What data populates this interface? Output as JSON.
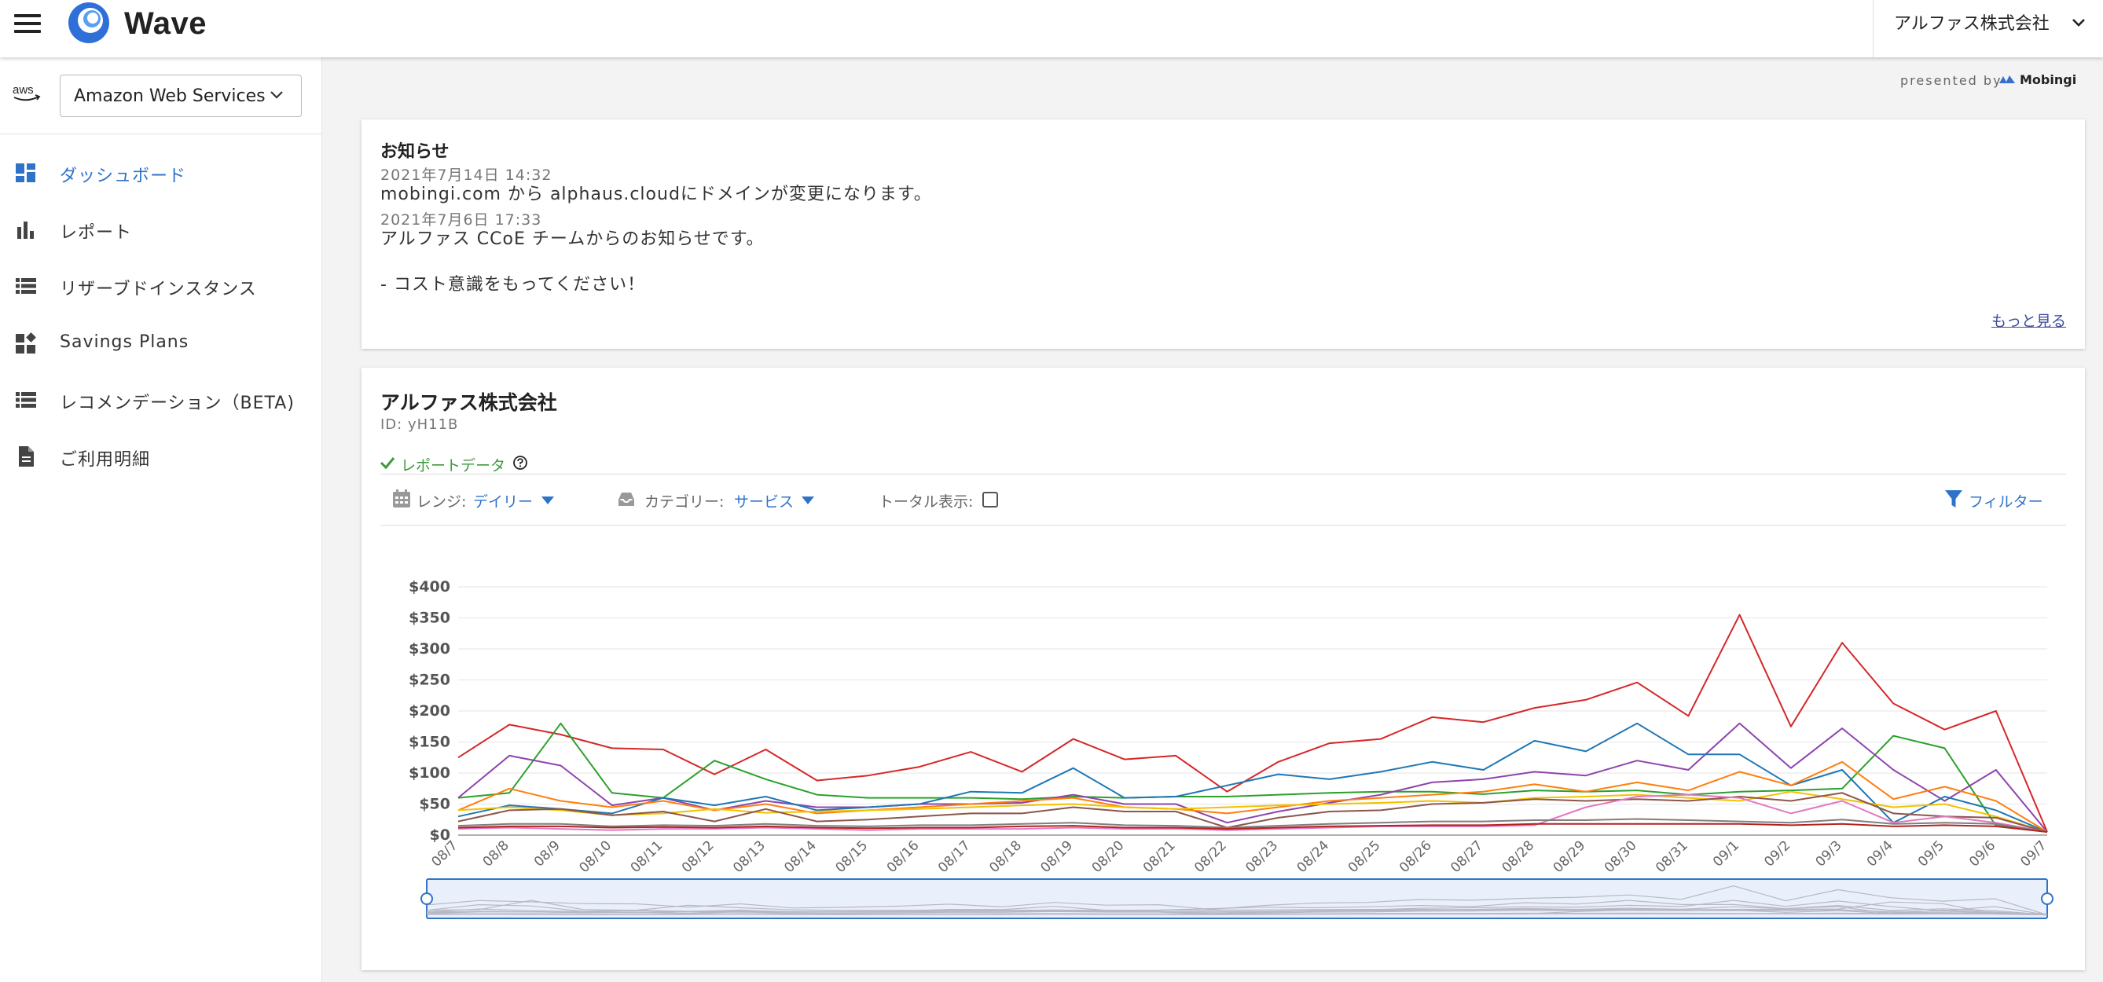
{
  "header": {
    "brand": "Wave",
    "org_selector": "アルファス株式会社",
    "icons": [
      "menu-icon",
      "wave-logo-icon",
      "chevron-down-icon"
    ]
  },
  "sidebar": {
    "cloud_provider": "Amazon Web Services",
    "provider_logo": "aws",
    "items": [
      {
        "label": "ダッシュボード",
        "icon": "dashboard-icon",
        "active": true
      },
      {
        "label": "レポート",
        "icon": "bar-chart-icon",
        "active": false
      },
      {
        "label": "リザーブドインスタンス",
        "icon": "list-icon",
        "active": false
      },
      {
        "label": "Savings Plans",
        "icon": "widgets-icon",
        "active": false
      },
      {
        "label": "レコメンデーション（BETA)",
        "icon": "list-icon",
        "active": false
      },
      {
        "label": "ご利用明細",
        "icon": "document-icon",
        "active": false
      }
    ]
  },
  "presented_by": {
    "label": "presented by",
    "brand": "Mobingi"
  },
  "notice": {
    "title": "お知らせ",
    "entries": [
      {
        "date": "2021年7月14日 14:32",
        "lines": [
          "mobingi.com から alphaus.cloudにドメインが変更になります。"
        ]
      },
      {
        "date": "2021年7月6日 17:33",
        "lines": [
          "アルファス CCoE チームからのお知らせです。",
          "- コスト意識をもってください！"
        ]
      }
    ],
    "more_link": "もっと見る"
  },
  "report": {
    "company": "アルファス株式会社",
    "account_id": "ID: yH11B",
    "data_label": "レポートデータ",
    "range_label": "レンジ:",
    "range_value": "デイリー",
    "category_label": "カテゴリー:",
    "category_value": "サービス",
    "total_label": "トータル表示:",
    "total_checked": false,
    "filter_label": "フィルター"
  },
  "colors": {
    "accent": "#2f73c8",
    "success": "#3c9a3c",
    "link": "#3c4a9a"
  },
  "chart_data": {
    "type": "line",
    "x": [
      "08/7",
      "08/8",
      "08/9",
      "08/10",
      "08/11",
      "08/12",
      "08/13",
      "08/14",
      "08/15",
      "08/16",
      "08/17",
      "08/18",
      "08/19",
      "08/20",
      "08/21",
      "08/22",
      "08/23",
      "08/24",
      "08/25",
      "08/26",
      "08/27",
      "08/28",
      "08/29",
      "08/30",
      "08/31",
      "09/1",
      "09/2",
      "09/3",
      "09/4",
      "09/5",
      "09/6",
      "09/7"
    ],
    "ylim": [
      0,
      400
    ],
    "yticks": [
      "$0",
      "$50",
      "$100",
      "$150",
      "$200",
      "$250",
      "$300",
      "$350",
      "$400"
    ],
    "grid": true,
    "legend": "none",
    "range_selector": true,
    "series": [
      {
        "color": "#d62728",
        "values": [
          125,
          178,
          162,
          140,
          138,
          98,
          138,
          88,
          96,
          110,
          134,
          102,
          155,
          122,
          128,
          70,
          118,
          148,
          155,
          190,
          182,
          205,
          218,
          246,
          192,
          355,
          175,
          310,
          212,
          170,
          200,
          5
        ]
      },
      {
        "color": "#2ca02c",
        "values": [
          60,
          68,
          180,
          68,
          60,
          120,
          90,
          65,
          60,
          60,
          60,
          58,
          62,
          60,
          62,
          62,
          65,
          68,
          70,
          70,
          66,
          72,
          70,
          72,
          65,
          70,
          72,
          75,
          160,
          140,
          15,
          5
        ]
      },
      {
        "color": "#8e44ad",
        "values": [
          60,
          128,
          112,
          48,
          60,
          40,
          55,
          45,
          45,
          50,
          50,
          52,
          65,
          50,
          50,
          20,
          38,
          52,
          65,
          85,
          90,
          102,
          96,
          120,
          105,
          180,
          108,
          172,
          105,
          55,
          105,
          5
        ]
      },
      {
        "color": "#1f77b4",
        "values": [
          30,
          48,
          42,
          35,
          60,
          48,
          62,
          40,
          45,
          50,
          70,
          68,
          108,
          60,
          62,
          80,
          98,
          90,
          102,
          118,
          105,
          152,
          135,
          180,
          130,
          130,
          80,
          105,
          20,
          62,
          40,
          5
        ]
      },
      {
        "color": "#ff7f0e",
        "values": [
          40,
          75,
          55,
          45,
          55,
          40,
          50,
          35,
          40,
          45,
          50,
          55,
          60,
          45,
          42,
          35,
          45,
          55,
          60,
          65,
          70,
          82,
          70,
          85,
          72,
          102,
          80,
          118,
          58,
          78,
          55,
          5
        ]
      },
      {
        "color": "#f2c200",
        "values": [
          40,
          45,
          40,
          32,
          35,
          42,
          36,
          38,
          40,
          42,
          45,
          48,
          50,
          45,
          42,
          45,
          48,
          50,
          52,
          55,
          52,
          60,
          62,
          65,
          60,
          55,
          70,
          58,
          45,
          50,
          30,
          5
        ]
      },
      {
        "color": "#8c564b",
        "values": [
          22,
          40,
          42,
          32,
          38,
          22,
          42,
          22,
          25,
          30,
          35,
          35,
          45,
          38,
          38,
          12,
          28,
          38,
          40,
          50,
          52,
          58,
          55,
          58,
          55,
          62,
          55,
          68,
          35,
          30,
          28,
          5
        ]
      },
      {
        "color": "#e377c2",
        "values": [
          10,
          12,
          10,
          8,
          10,
          10,
          12,
          10,
          8,
          10,
          10,
          10,
          12,
          10,
          10,
          8,
          10,
          12,
          14,
          14,
          14,
          16,
          45,
          62,
          65,
          60,
          35,
          55,
          20,
          30,
          20,
          5
        ]
      },
      {
        "color": "#7f7f7f",
        "values": [
          15,
          18,
          18,
          14,
          16,
          15,
          18,
          15,
          14,
          16,
          16,
          18,
          20,
          16,
          15,
          12,
          15,
          18,
          20,
          22,
          22,
          24,
          24,
          26,
          24,
          22,
          20,
          25,
          18,
          20,
          18,
          5
        ]
      },
      {
        "color": "#b22222",
        "values": [
          12,
          14,
          14,
          12,
          13,
          12,
          14,
          12,
          11,
          12,
          12,
          14,
          15,
          12,
          12,
          10,
          12,
          14,
          15,
          16,
          16,
          18,
          18,
          18,
          18,
          18,
          16,
          18,
          14,
          16,
          14,
          5
        ]
      }
    ]
  }
}
